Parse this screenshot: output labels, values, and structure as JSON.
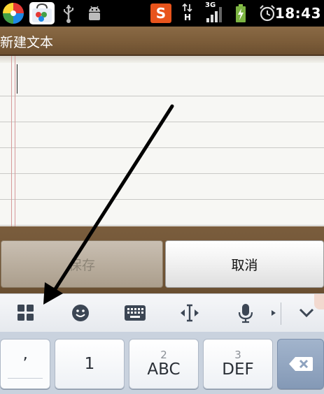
{
  "status_bar": {
    "time": "18:43",
    "network_type": "3G",
    "data_indicator": "H",
    "icons": [
      "pinwheel-app-icon",
      "app-store-icon",
      "usb-icon",
      "android-debug-icon",
      "sogou-input-icon",
      "data-transfer-icon",
      "signal-icon",
      "battery-charging-icon",
      "alarm-icon"
    ],
    "sogou_letter": "S"
  },
  "title_bar": {
    "title": "新建文本"
  },
  "editor": {
    "content": ""
  },
  "buttons": {
    "save_label": "保存",
    "cancel_label": "取消"
  },
  "keyboard": {
    "toolbar_icons": [
      "grid-menu-icon",
      "emoji-icon",
      "keyboard-icon",
      "cursor-move-icon",
      "microphone-icon",
      "expand-arrow-icon",
      "collapse-keyboard-icon"
    ],
    "keys": {
      "comma": {
        "label": "’"
      },
      "one": {
        "label": "1"
      },
      "two": {
        "sub": "2",
        "label": "ABC"
      },
      "three": {
        "sub": "3",
        "label": "DEF"
      },
      "backspace": {
        "icon": "backspace-icon"
      }
    }
  },
  "colors": {
    "title_bar": "#7a5b38",
    "paper": "#f7f7f4",
    "keyboard_bg": "#c9d2de",
    "backspace_key": "#8da2bf"
  }
}
